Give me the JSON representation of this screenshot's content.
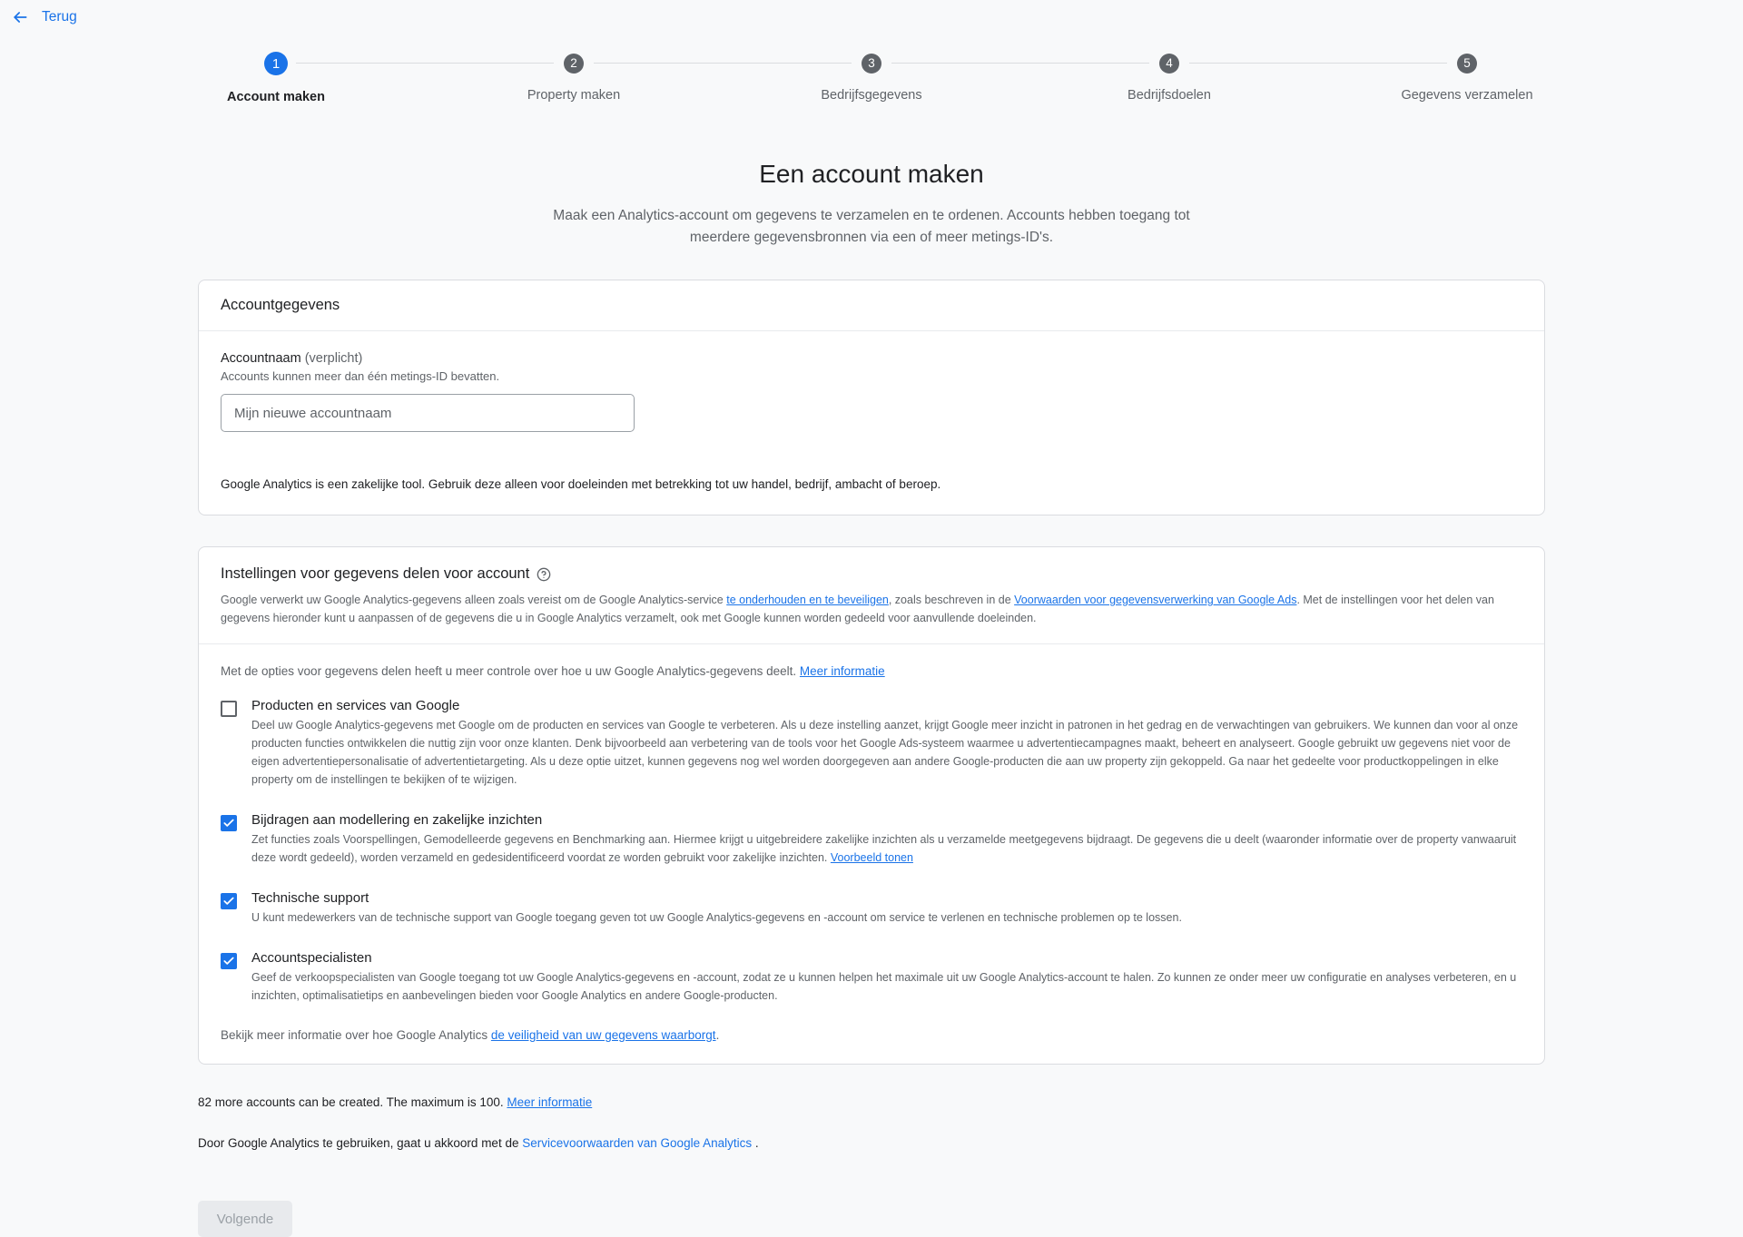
{
  "topbar": {
    "back_label": "Terug",
    "back_icon": "arrow-left-icon"
  },
  "stepper": {
    "steps": [
      {
        "num": "1",
        "label": "Account maken",
        "active": true
      },
      {
        "num": "2",
        "label": "Property maken",
        "active": false
      },
      {
        "num": "3",
        "label": "Bedrijfsgegevens",
        "active": false
      },
      {
        "num": "4",
        "label": "Bedrijfsdoelen",
        "active": false
      },
      {
        "num": "5",
        "label": "Gegevens verzamelen",
        "active": false
      }
    ]
  },
  "page": {
    "title": "Een account maken",
    "subtitle": "Maak een Analytics-account om gegevens te verzamelen en te ordenen. Accounts hebben toegang tot meerdere gegevensbronnen via een of meer metings-ID's."
  },
  "account_card": {
    "header": "Accountgegevens",
    "field_label": "Accountnaam",
    "field_required": "(verplicht)",
    "field_help": "Accounts kunnen meer dan één metings-ID bevatten.",
    "input_placeholder": "Mijn nieuwe accountnaam",
    "input_value": "",
    "note": "Google Analytics is een zakelijke tool. Gebruik deze alleen voor doeleinden met betrekking tot uw handel, bedrijf, ambacht of beroep."
  },
  "sharing_card": {
    "title": "Instellingen voor gegevens delen voor account",
    "help_icon": "help-circle-icon",
    "desc_part1": "Google verwerkt uw Google Analytics-gegevens alleen zoals vereist om de Google Analytics-service ",
    "desc_link1": "te onderhouden en te beveiligen",
    "desc_part2": ", zoals beschreven in de ",
    "desc_link2": "Voorwaarden voor gegevensverwerking van Google Ads",
    "desc_part3": ". Met de instellingen voor het delen van gegevens hieronder kunt u aanpassen of de gegevens die u in Google Analytics verzamelt, ook met Google kunnen worden gedeeld voor aanvullende doeleinden.",
    "intro_text": "Met de opties voor gegevens delen heeft u meer controle over hoe u uw Google Analytics-gegevens deelt. ",
    "intro_link": "Meer informatie",
    "options": [
      {
        "checked": false,
        "title": "Producten en services van Google",
        "desc": "Deel uw Google Analytics-gegevens met Google om de producten en services van Google te verbeteren. Als u deze instelling aanzet, krijgt Google meer inzicht in patronen in het gedrag en de verwachtingen van gebruikers. We kunnen dan voor al onze producten functies ontwikkelen die nuttig zijn voor onze klanten. Denk bijvoorbeeld aan verbetering van de tools voor het Google Ads-systeem waarmee u advertentiecampagnes maakt, beheert en analyseert. Google gebruikt uw gegevens niet voor de eigen advertentiepersonalisatie of advertentietargeting. Als u deze optie uitzet, kunnen gegevens nog wel worden doorgegeven aan andere Google-producten die aan uw property zijn gekoppeld. Ga naar het gedeelte voor productkoppelingen in elke property om de instellingen te bekijken of te wijzigen.",
        "link": ""
      },
      {
        "checked": true,
        "title": "Bijdragen aan modellering en zakelijke inzichten",
        "desc": "Zet functies zoals Voorspellingen, Gemodelleerde gegevens en Benchmarking aan. Hiermee krijgt u uitgebreidere zakelijke inzichten als u verzamelde meetgegevens bijdraagt. De gegevens die u deelt (waaronder informatie over de property vanwaaruit deze wordt gedeeld), worden verzameld en gedesidentificeerd voordat ze worden gebruikt voor zakelijke inzichten. ",
        "link": "Voorbeeld tonen"
      },
      {
        "checked": true,
        "title": "Technische support",
        "desc": "U kunt medewerkers van de technische support van Google toegang geven tot uw Google Analytics-gegevens en -account om service te verlenen en technische problemen op te lossen.",
        "link": ""
      },
      {
        "checked": true,
        "title": "Accountspecialisten",
        "desc": "Geef de verkoopspecialisten van Google toegang tot uw Google Analytics-gegevens en -account, zodat ze u kunnen helpen het maximale uit uw Google Analytics-account te halen. Zo kunnen ze onder meer uw configuratie en analyses verbeteren, en u inzichten, optimalisatietips en aanbevelingen bieden voor Google Analytics en andere Google-producten.",
        "link": ""
      }
    ],
    "footer_text": "Bekijk meer informatie over hoe Google Analytics ",
    "footer_link": "de veiligheid van uw gegevens waarborgt",
    "footer_end": "."
  },
  "bottom": {
    "quota_text": "82 more accounts can be created. The maximum is 100. ",
    "quota_link": "Meer informatie",
    "terms_text": "Door Google Analytics te gebruiken, gaat u akkoord met de ",
    "terms_link": "Servicevoorwaarden van Google Analytics ",
    "terms_end": ".",
    "next_label": "Volgende"
  },
  "colors": {
    "accent": "#1a73e8",
    "muted": "#5f6368",
    "border": "#dadce0",
    "bg": "#f8f9fa"
  }
}
